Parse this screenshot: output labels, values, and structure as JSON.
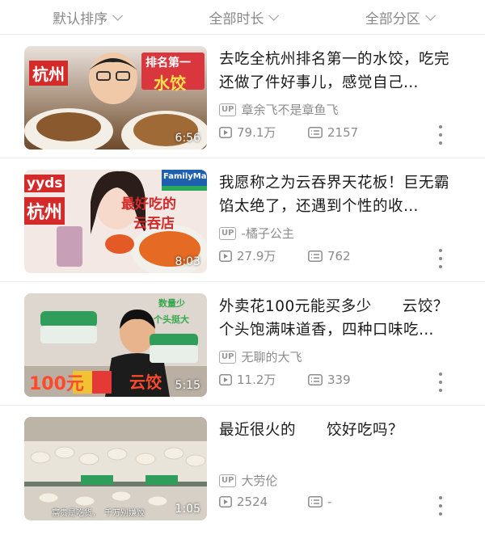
{
  "filters": [
    {
      "label": "默认排序"
    },
    {
      "label": "全部时长"
    },
    {
      "label": "全部分区"
    }
  ],
  "videos": [
    {
      "title": "去吃全杭州排名第一的水饺，吃完还做了件好事儿，感觉自己…",
      "uploader": "章余飞不是章鱼飞",
      "views": "79.1万",
      "comments": "2157",
      "duration": "6:56",
      "thumb_text": [
        "杭州",
        "排名第一",
        "水饺"
      ]
    },
    {
      "title": "我愿称之为云吞界天花板！巨无霸馅太绝了，还遇到个性的收…",
      "uploader": "-橘子公主",
      "views": "27.9万",
      "comments": "762",
      "duration": "8:03",
      "thumb_text": [
        "yyds",
        "杭州",
        "最好吃的",
        "云吞店",
        "FamilyMart"
      ]
    },
    {
      "title": "外卖花100元能买多少　　云饺？个头饱满味道香，四种口味吃…",
      "uploader": "无聊的大飞",
      "views": "11.2万",
      "comments": "339",
      "duration": "5:15",
      "thumb_text": [
        "100元",
        "云饺",
        "数量少",
        "个头挺大"
      ]
    },
    {
      "title": "最近很火的　　饺好吃吗？",
      "uploader": "大劳伦",
      "views": "2524",
      "comments": "-",
      "duration": "1:05",
      "thumb_text": [
        "富贵是吃货，　千万别嫌饺"
      ]
    }
  ],
  "labels": {
    "up_badge": "UP"
  }
}
